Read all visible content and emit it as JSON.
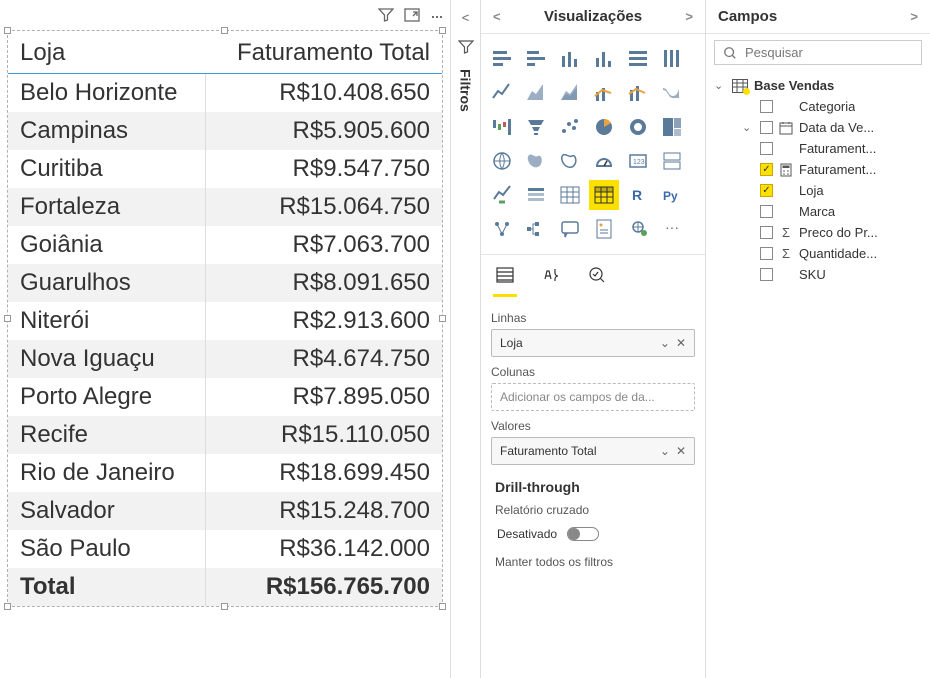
{
  "table": {
    "headers": [
      "Loja",
      "Faturamento Total"
    ],
    "rows": [
      [
        "Belo Horizonte",
        "R$10.408.650"
      ],
      [
        "Campinas",
        "R$5.905.600"
      ],
      [
        "Curitiba",
        "R$9.547.750"
      ],
      [
        "Fortaleza",
        "R$15.064.750"
      ],
      [
        "Goiânia",
        "R$7.063.700"
      ],
      [
        "Guarulhos",
        "R$8.091.650"
      ],
      [
        "Niterói",
        "R$2.913.600"
      ],
      [
        "Nova Iguaçu",
        "R$4.674.750"
      ],
      [
        "Porto Alegre",
        "R$7.895.050"
      ],
      [
        "Recife",
        "R$15.110.050"
      ],
      [
        "Rio de Janeiro",
        "R$18.699.450"
      ],
      [
        "Salvador",
        "R$15.248.700"
      ],
      [
        "São Paulo",
        "R$36.142.000"
      ]
    ],
    "total_label": "Total",
    "total_value": "R$156.765.700"
  },
  "filters_panel": {
    "label": "Filtros"
  },
  "viz_panel": {
    "title": "Visualizações",
    "wells": {
      "rows_label": "Linhas",
      "rows_value": "Loja",
      "cols_label": "Colunas",
      "cols_placeholder": "Adicionar os campos de da...",
      "values_label": "Valores",
      "values_value": "Faturamento Total"
    },
    "drillthrough_title": "Drill-through",
    "cross_report_label": "Relatório cruzado",
    "off_label": "Desativado",
    "keep_filters_label": "Manter todos os filtros"
  },
  "fields_panel": {
    "title": "Campos",
    "search_placeholder": "Pesquisar",
    "table_name": "Base Vendas",
    "fields": [
      {
        "label": "Categoria",
        "checked": false,
        "icon": ""
      },
      {
        "label": "Data da Ve...",
        "checked": false,
        "icon": "date",
        "expandable": true,
        "expanded": true
      },
      {
        "label": "Faturament...",
        "checked": false,
        "icon": ""
      },
      {
        "label": "Faturament...",
        "checked": true,
        "icon": "calc"
      },
      {
        "label": "Loja",
        "checked": true,
        "icon": ""
      },
      {
        "label": "Marca",
        "checked": false,
        "icon": ""
      },
      {
        "label": "Preco do Pr...",
        "checked": false,
        "icon": "sigma"
      },
      {
        "label": "Quantidade...",
        "checked": false,
        "icon": "sigma"
      },
      {
        "label": "SKU",
        "checked": false,
        "icon": ""
      }
    ]
  }
}
